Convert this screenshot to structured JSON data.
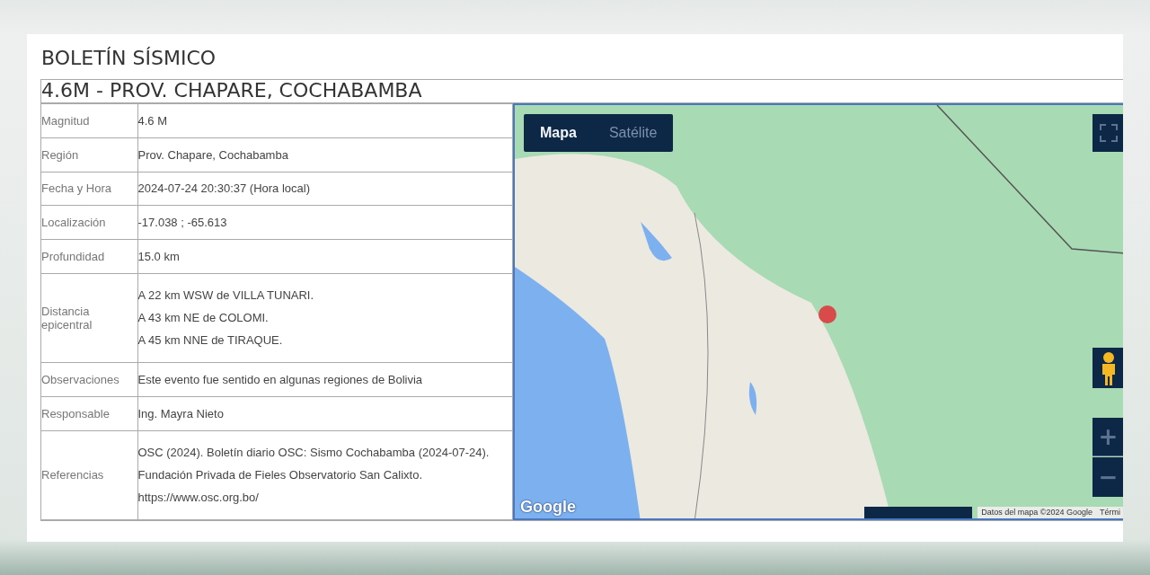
{
  "header": {
    "title": "BOLETÍN SÍSMICO"
  },
  "event": {
    "title": "4.6M - PROV. CHAPARE, COCHABAMBA",
    "rows": [
      {
        "label": "Magnitud",
        "lines": [
          "4.6 M"
        ]
      },
      {
        "label": "Región",
        "lines": [
          "Prov. Chapare, Cochabamba"
        ]
      },
      {
        "label": "Fecha y Hora",
        "lines": [
          "2024-07-24 20:30:37 (Hora local)"
        ]
      },
      {
        "label": "Localización",
        "lines": [
          "-17.038 ; -65.613"
        ]
      },
      {
        "label": "Profundidad",
        "lines": [
          "15.0 km"
        ]
      },
      {
        "label": "Distancia epicentral",
        "lines": [
          "A 22 km WSW de VILLA TUNARI.",
          "A 43 km NE de COLOMI.",
          "A 45 km NNE de TIRAQUE."
        ]
      },
      {
        "label": "Observaciones",
        "lines": [
          "Este evento fue sentido en algunas regiones de Bolivia"
        ]
      },
      {
        "label": "Responsable",
        "lines": [
          "Ing. Mayra Nieto"
        ]
      },
      {
        "label": "Referencias",
        "lines": [
          "OSC (2024). Boletín diario OSC: Sismo Cochabamba (2024-07-24).",
          "Fundación Privada de Fieles Observatorio San Calixto.",
          "https://www.osc.org.bo/"
        ]
      }
    ]
  },
  "map": {
    "tabs": [
      {
        "label": "Mapa",
        "selected": true
      },
      {
        "label": "Satélite",
        "selected": false
      }
    ],
    "zoom_in": "+",
    "zoom_out": "−",
    "logo": "Google",
    "attribution": "Datos del mapa ©2024 Google",
    "terms": "Térmi"
  }
}
